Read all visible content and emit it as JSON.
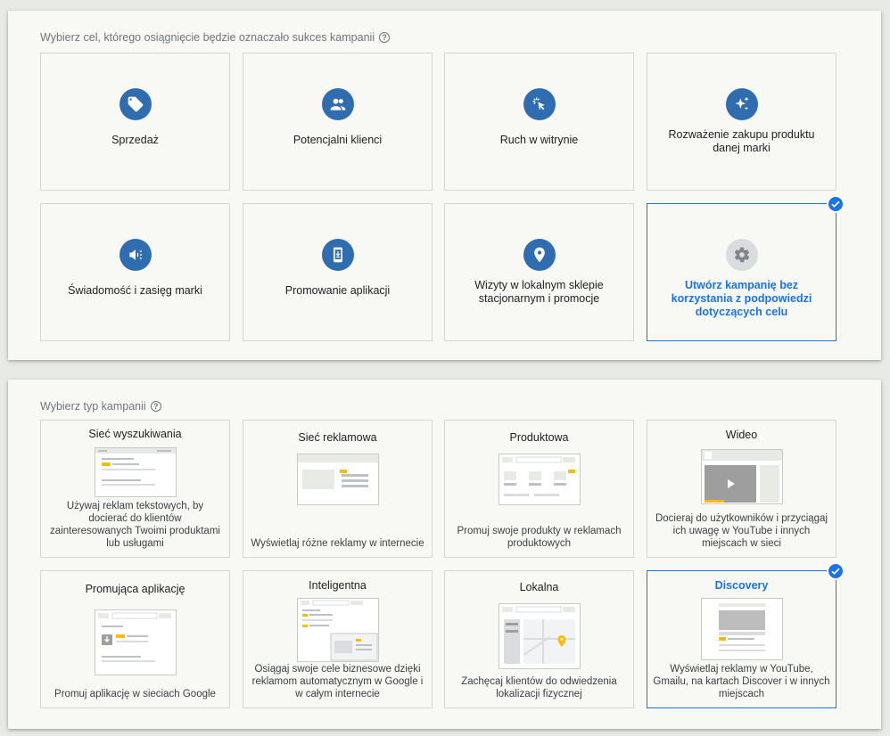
{
  "goals_section": {
    "title": "Wybierz cel, którego osiągnięcie będzie oznaczało sukces kampanii",
    "help": "?",
    "cards": [
      {
        "label": "Sprzedaż",
        "icon": "tag-icon"
      },
      {
        "label": "Potencjalni klienci",
        "icon": "people-icon"
      },
      {
        "label": "Ruch w witrynie",
        "icon": "cursor-click-icon"
      },
      {
        "label": "Rozważenie zakupu produktu danej marki",
        "icon": "sparkle-icon"
      },
      {
        "label": "Świadomość i zasięg marki",
        "icon": "megaphone-icon"
      },
      {
        "label": "Promowanie aplikacji",
        "icon": "phone-download-icon"
      },
      {
        "label": "Wizyty w lokalnym sklepie stacjonarnym i promocje",
        "icon": "location-pin-icon"
      },
      {
        "label": "Utwórz kampanię bez korzystania z podpowiedzi dotyczących celu",
        "icon": "gear-icon",
        "selected": true
      }
    ]
  },
  "types_section": {
    "title": "Wybierz typ kampanii",
    "help": "?",
    "cards": [
      {
        "title": "Sieć wyszukiwania",
        "desc": "Używaj reklam tekstowych, by docierać do klientów zainteresowanych Twoimi produktami lub usługami"
      },
      {
        "title": "Sieć reklamowa",
        "desc": "Wyświetlaj różne reklamy w internecie"
      },
      {
        "title": "Produktowa",
        "desc": "Promuj swoje produkty w reklamach produktowych"
      },
      {
        "title": "Wideo",
        "desc": "Docieraj do użytkowników i przyciągaj ich uwagę w YouTube i innych miejscach w sieci"
      },
      {
        "title": "Promująca aplikację",
        "desc": "Promuj aplikację w sieciach Google"
      },
      {
        "title": "Inteligentna",
        "desc": "Osiągaj swoje cele biznesowe dzięki reklamom automatycznym w Google i w całym internecie"
      },
      {
        "title": "Lokalna",
        "desc": "Zachęcaj klientów do odwiedzenia lokalizacji fizycznej"
      },
      {
        "title": "Discovery",
        "desc": "Wyświetlaj reklamy w YouTube, Gmailu, na kartach Discover i w innych miejscach",
        "selected": true
      }
    ]
  },
  "colors": {
    "accent": "#1a73e8",
    "icon_bg": "#2f6db0",
    "highlight": "#fbbc04"
  }
}
